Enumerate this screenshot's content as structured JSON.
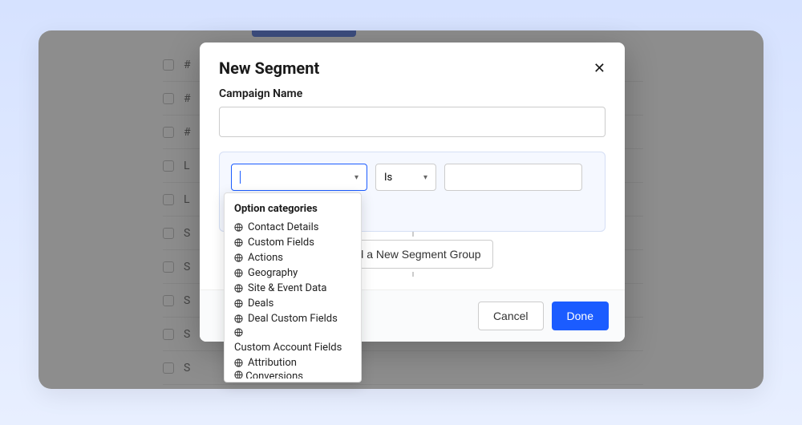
{
  "background": {
    "rows": [
      "#",
      "#",
      "#",
      "L",
      "L",
      "S",
      "S",
      "S",
      "S",
      "S"
    ]
  },
  "modal": {
    "title": "New Segment",
    "campaign_label": "Campaign Name",
    "campaign_value": "",
    "operator_label": "Is",
    "add_group_label": "Add a New Segment Group",
    "cancel_label": "Cancel",
    "done_label": "Done"
  },
  "dropdown": {
    "header": "Option categories",
    "items": [
      "Contact Details",
      "Custom Fields",
      "Actions",
      "Geography",
      "Site & Event Data",
      "Deals",
      "Deal Custom Fields",
      "Custom Account Fields",
      "Attribution"
    ],
    "cutoff": "Conversions"
  }
}
